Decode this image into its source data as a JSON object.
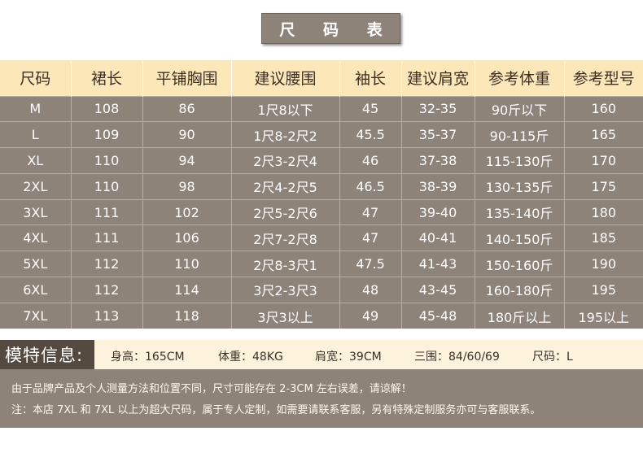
{
  "title": "尺 码 表",
  "headers": [
    "尺码",
    "裙长",
    "平铺胸围",
    "建议腰围",
    "袖长",
    "建议肩宽",
    "参考体重",
    "参考型号"
  ],
  "rows": [
    [
      "M",
      "108",
      "86",
      "1尺8以下",
      "45",
      "32-35",
      "90斤以下",
      "160"
    ],
    [
      "L",
      "109",
      "90",
      "1尺8-2尺2",
      "45.5",
      "35-37",
      "90-115斤",
      "165"
    ],
    [
      "XL",
      "110",
      "94",
      "2尺3-2尺4",
      "46",
      "37-38",
      "115-130斤",
      "170"
    ],
    [
      "2XL",
      "110",
      "98",
      "2尺4-2尺5",
      "46.5",
      "38-39",
      "130-135斤",
      "175"
    ],
    [
      "3XL",
      "111",
      "102",
      "2尺5-2尺6",
      "47",
      "39-40",
      "135-140斤",
      "180"
    ],
    [
      "4XL",
      "111",
      "106",
      "2尺7-2尺8",
      "47",
      "40-41",
      "140-150斤",
      "185"
    ],
    [
      "5XL",
      "112",
      "110",
      "2尺8-3尺1",
      "47.5",
      "41-43",
      "150-160斤",
      "190"
    ],
    [
      "6XL",
      "112",
      "114",
      "3尺2-3尺3",
      "48",
      "43-45",
      "160-180斤",
      "195"
    ],
    [
      "7XL",
      "113",
      "118",
      "3尺3以上",
      "49",
      "45-48",
      "180斤以上",
      "195以上"
    ]
  ],
  "model": {
    "label": "模特信息:",
    "height": "身高：165CM",
    "weight": "体重：48KG",
    "shoulder": "肩宽：39CM",
    "measurements": "三围：84/60/69",
    "size": "尺码：L"
  },
  "notes": [
    "由于品牌产品及个人测量方法和位置不同，尺寸可能存在 2-3CM 左右误差，请谅解！",
    "注：本店 7XL 和 7XL 以上为超大尺码，属于专人定制，如需要请联系客服，另有特殊定制服务亦可与客服联系。"
  ]
}
